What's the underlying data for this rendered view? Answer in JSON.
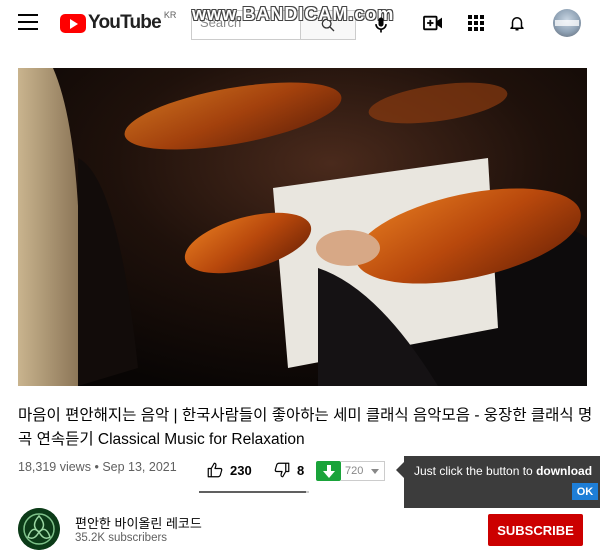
{
  "header": {
    "region": "KR",
    "logo_text": "YouTube",
    "search_placeholder": "Search",
    "watermark": "www.BANDICAM.com"
  },
  "video": {
    "title": "마음이 편안해지는 음악 | 한국사람들이 좋아하는 세미 클래식 음악모음 - 웅장한 클래식 명곡 연속듣기 Classical Music for Relaxation",
    "views": "18,319 views",
    "date": "Sep 13, 2021",
    "likes": "230",
    "dislikes": "8",
    "like_fraction": 0.97
  },
  "download": {
    "quality": "720",
    "tooltip_prefix": "Just click the button to ",
    "tooltip_bold": "download",
    "ok_label": "OK"
  },
  "channel": {
    "name": "편안한 바이올린 레코드",
    "subscribers": "35.2K subscribers",
    "subscribe_label": "SUBSCRIBE"
  },
  "colors": {
    "brand_red": "#ff0000",
    "subscribe_red": "#cc0000",
    "download_green": "#1aa33a",
    "ok_blue": "#1e7ed7"
  },
  "icons": [
    "menu-icon",
    "youtube-logo",
    "search-icon",
    "mic-icon",
    "create-video-icon",
    "apps-icon",
    "bell-icon",
    "thumb-up-icon",
    "thumb-down-icon",
    "download-arrow-icon"
  ]
}
